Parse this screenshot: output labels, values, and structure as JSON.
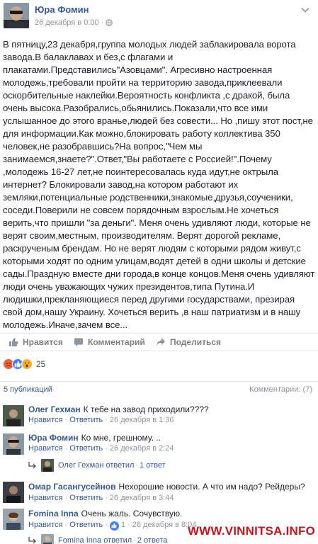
{
  "post": {
    "author": "Юра Фомин",
    "timestamp": "26 декабря в 0:00",
    "privacy_icon": "globe-icon",
    "menu_icon": "chevron-down-icon",
    "body": "В пятницу,23 декабря,группа молодых людей заблакировала ворота завода.В балаклавах и без,с флагами и плакатами.Представились\"Азовцами\". Агресивно настроенная молодежь,требовали пройти на территорию завода,приклеевали оскорбительные наклейки.Вероятность конфликта ,с дракой, была очень высока.Разобрались,обьянились.Показали,что все ими услышанное до этого вранье,людей без совести... Но ,пишу этот пост,не для информации.Как можно,блокировать работу коллектива 350 человек,не разобравшись?На вопрос,\"Чем мы занимаемся,знаете?\".Ответ,\"Вы работаете с Россией!\".Почему ,молодежь 16-27 лет,не поинтересовалась куда идут,не октрыла интернет? Блокировали завод,на котором работают их земляки,потенциальные родственники,знакомые,друзья,соученики, соседи.Поверили не совсем порядочным взрослым.Не хочеться верить,что пришли \"за деньги\". Меня очень удивляют люди, которые не верят своим,местным, производителям. Верят дорогой рекламе, раскрученым брендам. Но не верят людям с которыми рядом живут,с которыми ходят по одним улицам,водят детей в одни школы и детские сады.Праздную вместе дни города,в конце концов.Меня очень удивляют люди очень уважающих чужих президентов,типа Путина.И людишки,прекланяющиеся перед другими государствами, презирая свой дом,нашу Украину. Хочеться верить ,в наш патриатизм и в нашу молодежь.Иначе,зачем все..."
  },
  "actions": {
    "like": "Нравится",
    "comment": "Комментарий",
    "share": "Поделиться"
  },
  "reactions": {
    "count": "25",
    "types": [
      "angry",
      "like",
      "wow"
    ],
    "colors": {
      "angry": "#f05f3b",
      "like": "#4080ff",
      "wow": "#f7b125"
    }
  },
  "summary": {
    "shares": "5 публикаций",
    "comments": "Комментарии: (7)"
  },
  "comments": [
    {
      "name": "Олег Гехман",
      "text": "К тебе на завод приходили????",
      "like": "Нравится",
      "reply": "Ответить",
      "time": "26 декабря в 1:36"
    },
    {
      "name": "Юра Фомин",
      "text": "Ко мне, грешному. ..",
      "like": "Нравится",
      "reply": "Ответить",
      "time": "26 декабря в 2:24",
      "replies": {
        "who": "Олег Гехман ответил",
        "count": "1 ответ"
      }
    },
    {
      "name": "Омар Гасангусейнов",
      "text": "Нехорошие новости. А что им надо? Рейдеры?",
      "like": "Нравится",
      "reply": "Ответить",
      "time": "26 декабря в 3:44"
    },
    {
      "name": "Fomina Inna",
      "text": "Очень жаль. Сочувствую.",
      "like": "Нравится",
      "reply": "Ответить",
      "likes": "1",
      "time": "26 декабря в 8:04",
      "replies": {
        "who": "Fomina Inna ответил",
        "count": "2 ответа"
      }
    }
  ],
  "watermark": "WWW.VINNITSA.INFO"
}
